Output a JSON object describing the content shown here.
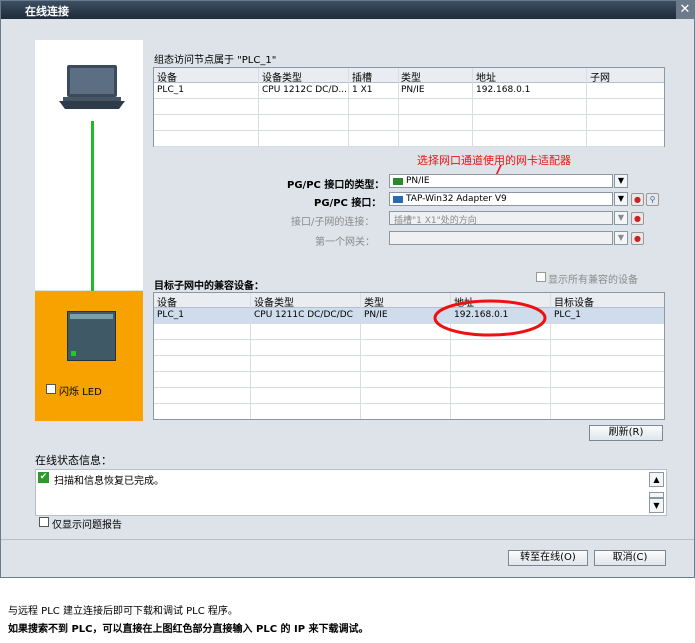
{
  "window": {
    "title": "在线连接",
    "close_glyph": "✕"
  },
  "configured_node": {
    "caption": "组态访问节点属于 \"PLC_1\"",
    "columns": [
      "设备",
      "设备类型",
      "插槽",
      "类型",
      "地址",
      "子网"
    ],
    "rows": [
      [
        "PLC_1",
        "CPU 1212C DC/D...",
        "1 X1",
        "PN/IE",
        "192.168.0.1",
        ""
      ]
    ]
  },
  "annotation": "选择网口通道使用的网卡适配器",
  "interface": {
    "type_label": "PG/PC 接口的类型：",
    "type_value": "PN/IE",
    "iface_label": "PG/PC 接口：",
    "iface_value": "TAP-Win32 Adapter V9",
    "conn_label": "接口/子网的连接：",
    "conn_value": "插槽\"1 X1\"处的方向",
    "gateway_label": "第一个网关："
  },
  "compatible": {
    "caption": "目标子网中的兼容设备：",
    "show_all_label": "显示所有兼容的设备",
    "columns": [
      "设备",
      "设备类型",
      "类型",
      "地址",
      "目标设备"
    ],
    "rows": [
      [
        "PLC_1",
        "CPU 1211C DC/DC/DC",
        "PN/IE",
        "192.168.0.1",
        "PLC_1"
      ]
    ]
  },
  "flash_led_label": "闪烁 LED",
  "refresh_label": "刷新(R)",
  "status": {
    "caption": "在线状态信息：",
    "message": "扫描和信息恢复已完成。"
  },
  "only_problems_label": "仅显示问题报告",
  "buttons": {
    "goto_online": "转至在线(O)",
    "cancel": "取消(C)"
  },
  "footer": {
    "line1": "与远程 PLC 建立连接后即可下载和调试 PLC 程序。",
    "line2": "如果搜索不到 PLC，可以直接在上图红色部分直接输入 PLC 的 IP 来下载调试。"
  }
}
